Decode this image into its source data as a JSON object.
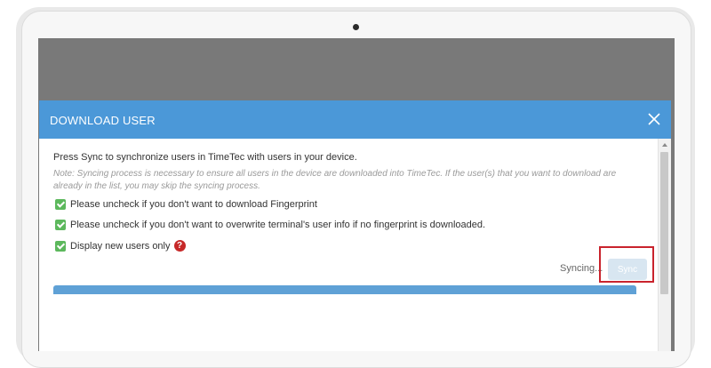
{
  "dialog": {
    "title": "DOWNLOAD USER",
    "intro": "Press Sync to synchronize users in TimeTec with users in your device.",
    "note": "Note: Syncing process is necessary to ensure all users in the device are downloaded into TimeTec. If the user(s) that you want to download are already in the list, you may skip the syncing process.",
    "options": [
      {
        "label": "Please uncheck if you don't want to download Fingerprint",
        "checked": true
      },
      {
        "label": "Please uncheck if you don't want to overwrite terminal's user info if no fingerprint is downloaded.",
        "checked": true
      },
      {
        "label": "Display new users only",
        "checked": true
      }
    ],
    "status": "Syncing...",
    "sync_label": "Sync"
  },
  "colors": {
    "header": "#4b98d8",
    "checkbox": "#5cb85c",
    "highlight": "#c9232d",
    "help_icon": "#c62828"
  },
  "icons": {
    "close": "close-icon",
    "help": "help-icon",
    "checkbox": "checkbox-checked-icon"
  }
}
